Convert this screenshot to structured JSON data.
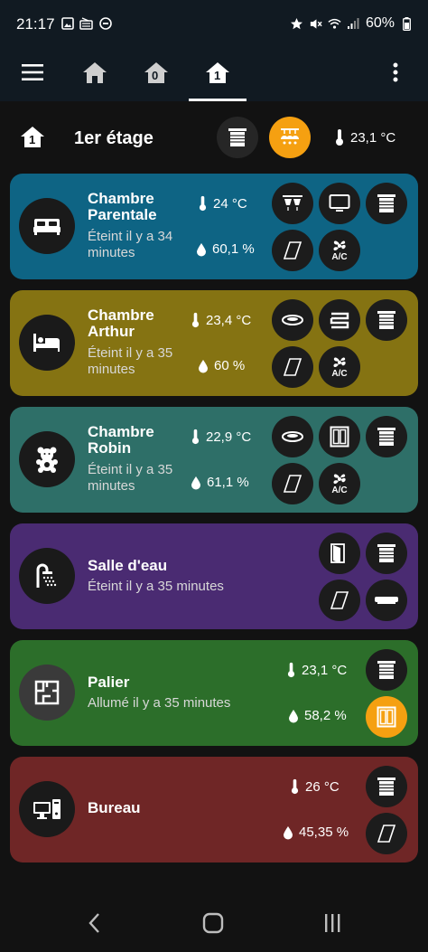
{
  "status_bar": {
    "time": "21:17",
    "battery": "60%"
  },
  "top_nav": {
    "tabs": [
      "home",
      "floor-0",
      "floor-1"
    ],
    "active": "floor-1",
    "tab_labels": [
      "",
      "0",
      "1"
    ]
  },
  "floor": {
    "badge": "1",
    "title": "1er étage",
    "temperature": "23,1 °C"
  },
  "rooms": [
    {
      "name": "Chambre Parentale",
      "status": "Éteint il y a 34 minutes",
      "temperature": "24 °C",
      "humidity": "60,1 %",
      "color": "#0e6484"
    },
    {
      "name": "Chambre Arthur",
      "status": "Éteint il y a 35 minutes",
      "temperature": "23,4 °C",
      "humidity": "60 %",
      "color": "#857312"
    },
    {
      "name": "Chambre Robin",
      "status": "Éteint il y a 35 minutes",
      "temperature": "22,9 °C",
      "humidity": "61,1 %",
      "color": "#2e6f68"
    },
    {
      "name": "Salle d'eau",
      "status": "Éteint il y a 35 minutes",
      "color": "#4a2b72"
    },
    {
      "name": "Palier",
      "status": "Allumé il y a 35 minutes",
      "temperature": "23,1 °C",
      "humidity": "58,2 %",
      "color": "#2c6e2a"
    },
    {
      "name": "Bureau",
      "temperature": "26 °C",
      "humidity": "45,35 %",
      "color": "#6f2626"
    }
  ],
  "icons": {
    "ac_label": "A/C"
  },
  "colors": {
    "accent": "#f5a011",
    "bar": "#111a22"
  }
}
